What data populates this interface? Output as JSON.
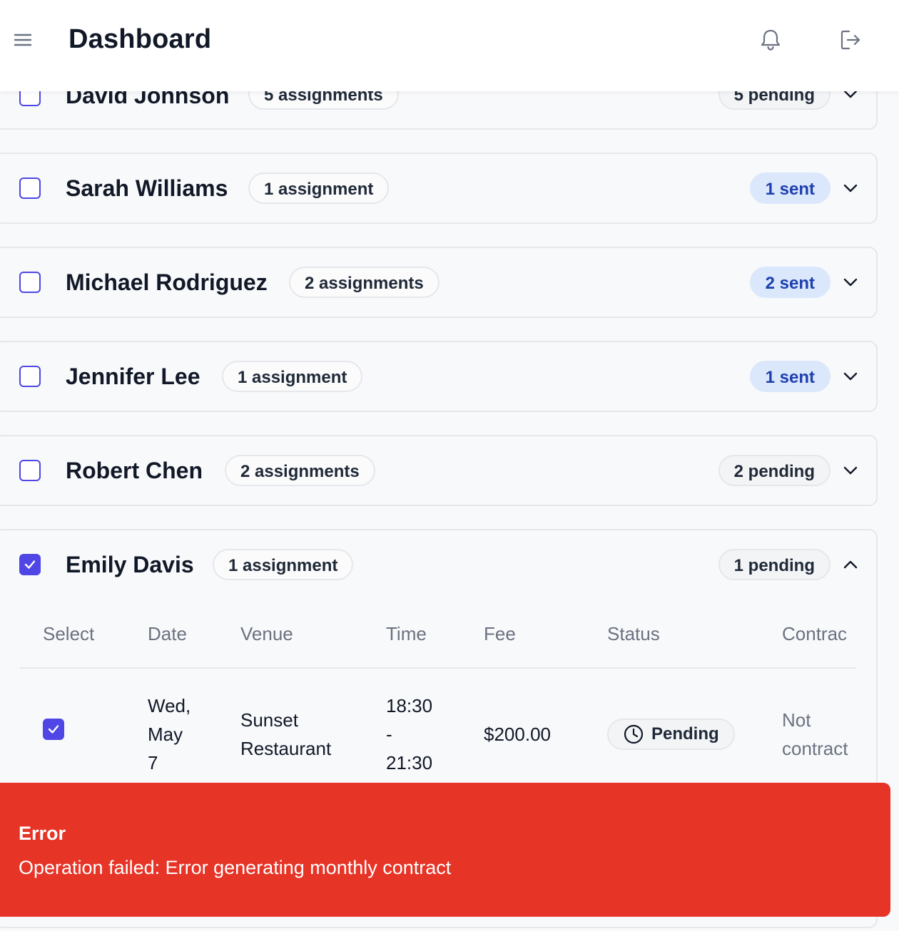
{
  "header": {
    "title": "Dashboard",
    "icons": [
      "menu-icon",
      "bell-icon",
      "logout-icon"
    ]
  },
  "musicians": [
    {
      "name": "David Johnson",
      "assignments": "5 assignments",
      "status": "5 pending",
      "status_type": "pending",
      "checked": false,
      "expanded": false
    },
    {
      "name": "Sarah Williams",
      "assignments": "1 assignment",
      "status": "1 sent",
      "status_type": "sent",
      "checked": false,
      "expanded": false
    },
    {
      "name": "Michael Rodriguez",
      "assignments": "2 assignments",
      "status": "2 sent",
      "status_type": "sent",
      "checked": false,
      "expanded": false
    },
    {
      "name": "Jennifer Lee",
      "assignments": "1 assignment",
      "status": "1 sent",
      "status_type": "sent",
      "checked": false,
      "expanded": false
    },
    {
      "name": "Robert Chen",
      "assignments": "2 assignments",
      "status": "2 pending",
      "status_type": "pending",
      "checked": false,
      "expanded": false
    },
    {
      "name": "Emily Davis",
      "assignments": "1 assignment",
      "status": "1 pending",
      "status_type": "pending",
      "checked": true,
      "expanded": true
    }
  ],
  "table": {
    "headers": {
      "select": "Select",
      "date": "Date",
      "venue": "Venue",
      "time": "Time",
      "fee": "Fee",
      "status": "Status",
      "contract": "Contrac"
    },
    "rows": [
      {
        "selected": true,
        "date_line1": "Wed,",
        "date_line2": "May",
        "date_line3": "7",
        "venue_line1": "Sunset",
        "venue_line2": "Restaurant",
        "time_line1": "18:30",
        "time_line2": "-",
        "time_line3": "21:30",
        "fee": "$200.00",
        "status": "Pending",
        "contract_line1": "Not",
        "contract_line2": "contract"
      }
    ]
  },
  "toast": {
    "title": "Error",
    "message": "Operation failed: Error generating monthly contract",
    "color": "#e63427"
  },
  "colors": {
    "accent": "#4f46e5",
    "sent_bg": "#dbe7fb",
    "sent_text": "#1e40af"
  }
}
